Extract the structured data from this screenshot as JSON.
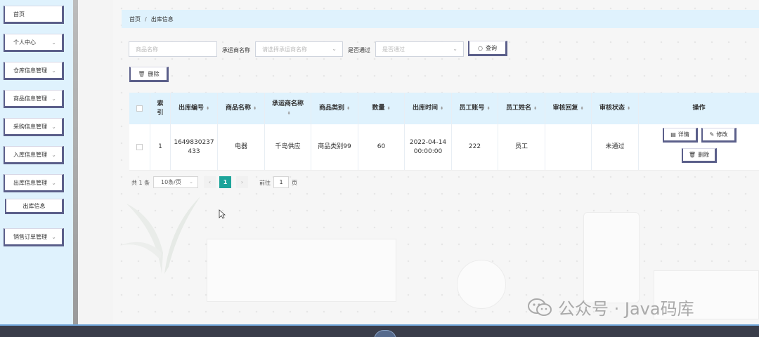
{
  "sidebar": {
    "items": [
      {
        "label": "首页",
        "has_arrow": false
      },
      {
        "label": "个人中心",
        "has_arrow": true
      },
      {
        "label": "仓库信息管理",
        "has_arrow": true
      },
      {
        "label": "商品信息管理",
        "has_arrow": true
      },
      {
        "label": "采购信息管理",
        "has_arrow": true
      },
      {
        "label": "入库信息管理",
        "has_arrow": true
      },
      {
        "label": "出库信息管理",
        "has_arrow": true
      },
      {
        "label": "出库信息",
        "sub": true
      },
      {
        "label": "销售订单管理",
        "has_arrow": true
      }
    ]
  },
  "breadcrumb": {
    "home": "首页",
    "sep": "/",
    "current": "出库信息"
  },
  "filters": {
    "product_name_placeholder": "商品名称",
    "supplier_label": "承运商名称",
    "supplier_placeholder": "请选择承运商名称",
    "approved_label": "是否通过",
    "approved_placeholder": "是否通过",
    "search_label": "查询",
    "delete_label": "删除"
  },
  "table": {
    "headers": [
      "索引",
      "出库编号",
      "商品名称",
      "承运商名称",
      "商品类别",
      "数量",
      "出库时间",
      "员工账号",
      "员工姓名",
      "审核回复",
      "审核状态",
      "操作"
    ],
    "rows": [
      {
        "index": "1",
        "code_line1": "1649830237",
        "code_line2": "433",
        "product": "电器",
        "supplier": "千岛供应",
        "category": "商品类别99",
        "quantity": "60",
        "time_line1": "2022-04-14",
        "time_line2": "00:00:00",
        "account": "222",
        "employee": "员工",
        "reply": "",
        "status": "未通过",
        "actions": {
          "detail": "详情",
          "edit": "修改",
          "delete": "删除"
        }
      }
    ]
  },
  "pagination": {
    "total": "共 1 条",
    "page_size": "10条/页",
    "current_page": "1",
    "goto_prefix": "前往",
    "goto_value": "1",
    "goto_suffix": "页"
  },
  "watermark": "公众号 · Java码库",
  "colors": {
    "accent": "#1da49a",
    "header_bg": "#dff2fd",
    "button_border": "#5b5f8a"
  }
}
